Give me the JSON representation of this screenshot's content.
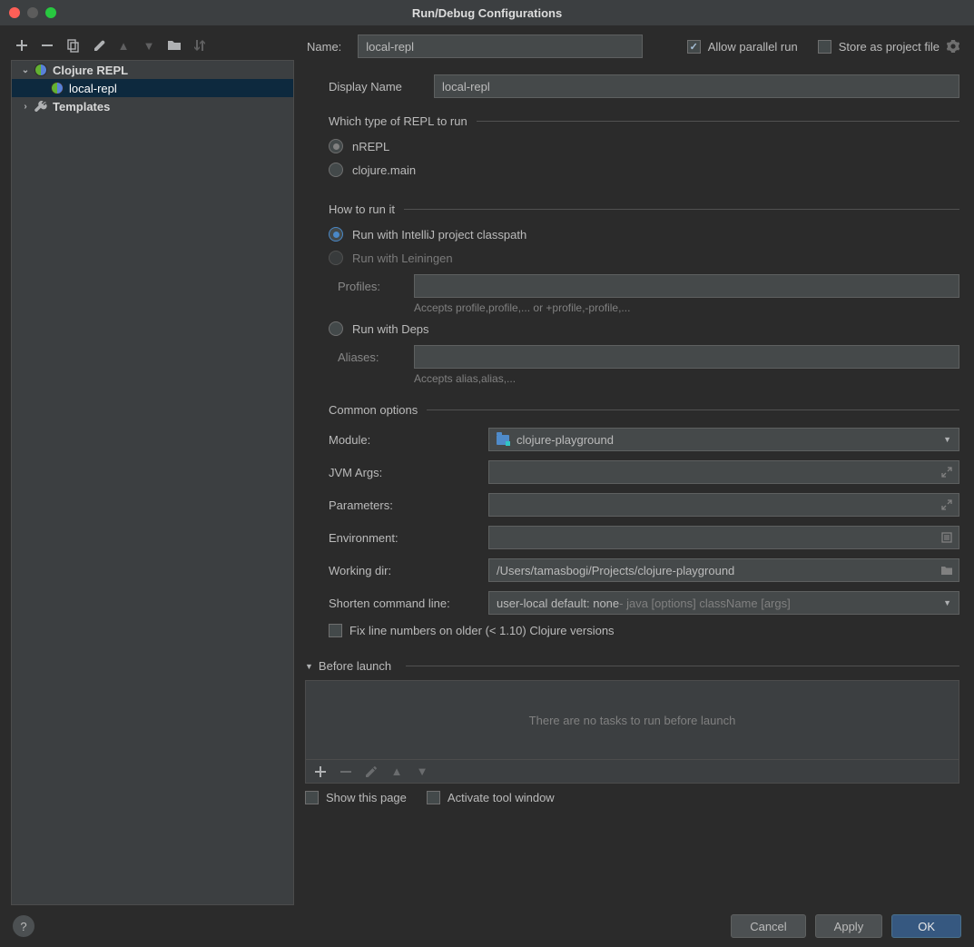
{
  "window": {
    "title": "Run/Debug Configurations"
  },
  "sidebar": {
    "items": [
      {
        "label": "Clojure REPL",
        "expanded": true,
        "icon": "clojure"
      },
      {
        "label": "local-repl",
        "icon": "clojure",
        "selected": true
      },
      {
        "label": "Templates",
        "expanded": false,
        "icon": "wrench"
      }
    ]
  },
  "header": {
    "name_label": "Name:",
    "name_value": "local-repl",
    "allow_parallel_label": "Allow parallel run",
    "allow_parallel_checked": true,
    "store_project_label": "Store as project file",
    "store_project_checked": false
  },
  "display_name": {
    "label": "Display Name",
    "value": "local-repl"
  },
  "repl_type": {
    "header": "Which type of REPL to run",
    "options": {
      "nrepl": {
        "label": "nREPL",
        "selected": true
      },
      "clojure_main": {
        "label": "clojure.main",
        "selected": false
      }
    }
  },
  "how_run": {
    "header": "How to run it",
    "intellij": {
      "label": "Run with IntelliJ project classpath",
      "selected": true
    },
    "leiningen": {
      "label": "Run with Leiningen",
      "selected": false,
      "disabled": true
    },
    "profiles_label": "Profiles:",
    "profiles_value": "",
    "profiles_hint": "Accepts profile,profile,... or +profile,-profile,...",
    "deps": {
      "label": "Run with Deps",
      "selected": false
    },
    "aliases_label": "Aliases:",
    "aliases_value": "",
    "aliases_hint": "Accepts alias,alias,..."
  },
  "common": {
    "header": "Common options",
    "module_label": "Module:",
    "module_value": "clojure-playground",
    "jvm_label": "JVM Args:",
    "jvm_value": "",
    "params_label": "Parameters:",
    "params_value": "",
    "env_label": "Environment:",
    "env_value": "",
    "workdir_label": "Working dir:",
    "workdir_value": "/Users/tamasbogi/Projects/clojure-playground",
    "shorten_label": "Shorten command line:",
    "shorten_main": "user-local default: none",
    "shorten_gray": " - java [options] className [args]",
    "fix_lines_label": "Fix line numbers on older (< 1.10) Clojure versions",
    "fix_lines_checked": false
  },
  "before_launch": {
    "header": "Before launch",
    "empty_text": "There are no tasks to run before launch",
    "show_page_label": "Show this page",
    "show_page_checked": false,
    "activate_tool_label": "Activate tool window",
    "activate_tool_checked": false
  },
  "footer": {
    "cancel": "Cancel",
    "apply": "Apply",
    "ok": "OK"
  }
}
